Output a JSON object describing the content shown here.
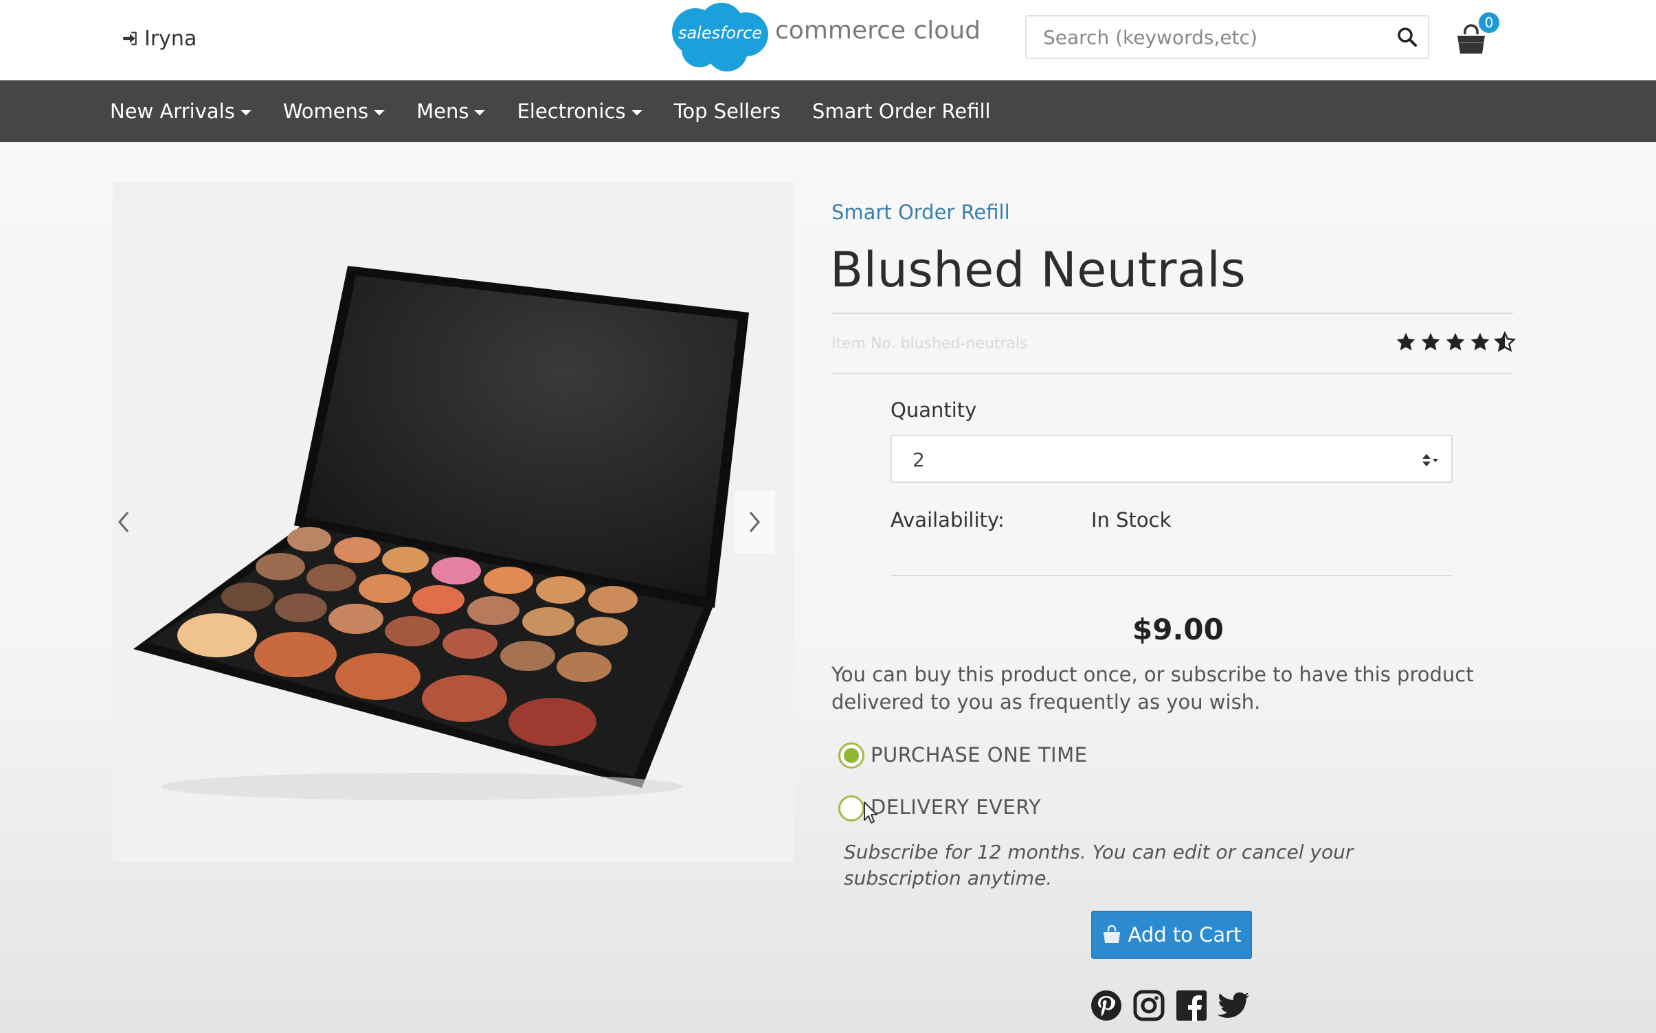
{
  "header": {
    "user_name": "Iryna",
    "brand_cloud_text": "salesforce",
    "brand_text": "commerce cloud",
    "search_placeholder": "Search (keywords,etc)",
    "cart_count": "0"
  },
  "nav": {
    "items": [
      {
        "label": "New Arrivals",
        "dropdown": true
      },
      {
        "label": "Womens",
        "dropdown": true
      },
      {
        "label": "Mens",
        "dropdown": true
      },
      {
        "label": "Electronics",
        "dropdown": true
      },
      {
        "label": "Top Sellers",
        "dropdown": false
      },
      {
        "label": "Smart Order Refill",
        "dropdown": false
      }
    ]
  },
  "product": {
    "breadcrumb": "Smart Order Refill",
    "title": "Blushed Neutrals",
    "item_no": "Item No. blushed-neutrals",
    "rating": 4.5,
    "rating_max": 5,
    "quantity_label": "Quantity",
    "quantity_value": "2",
    "availability_label": "Availability:",
    "availability_value": "In Stock",
    "price": "$9.00",
    "description": "You can buy this product once, or subscribe to have this product delivered to you as frequently as you wish.",
    "options": {
      "one_time": "PURCHASE ONE TIME",
      "delivery": "DELIVERY EVERY",
      "selected": "one_time"
    },
    "subscription_note": "Subscribe for 12 months. You can edit or cancel your subscription anytime.",
    "add_to_cart": "Add to Cart"
  },
  "social": [
    "pinterest-icon",
    "instagram-icon",
    "facebook-icon",
    "twitter-icon"
  ],
  "colors": {
    "nav_bg": "#464646",
    "link": "#3a7fb0",
    "button": "#2c8bd0",
    "radio": "#8fb634",
    "badge": "#1b9ad6"
  }
}
